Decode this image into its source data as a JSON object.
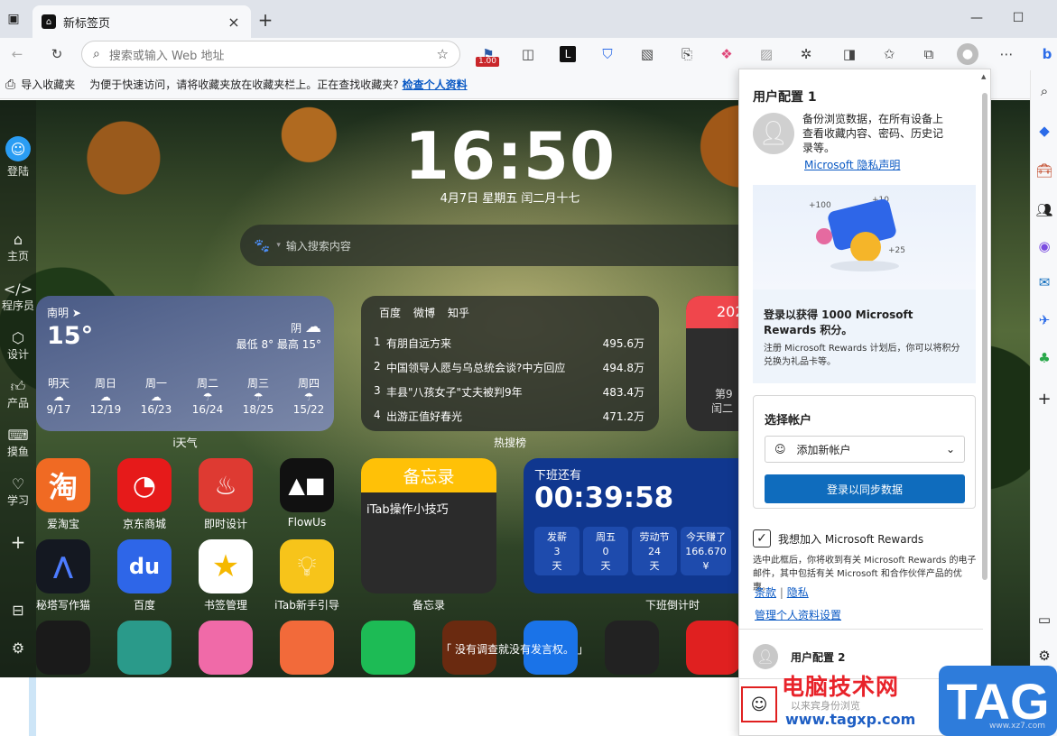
{
  "browser": {
    "tab_title": "新标签页",
    "address_placeholder": "搜索或输入 Web 地址",
    "extension_badge": "1.00",
    "favorites_bar": {
      "import_label": "导入收藏夹",
      "hint": "为便于快速访问，请将收藏夹放在收藏夹栏上。正在查找收藏夹?",
      "link": "检查个人资料"
    }
  },
  "itab": {
    "login_label": "登陆",
    "nav": [
      "主页",
      "程序员",
      "设计",
      "产品",
      "摸鱼",
      "学习"
    ],
    "clock": {
      "time": "16:50",
      "date": "4月7日  星期五  闰二月十七"
    },
    "search_placeholder": "输入搜索内容",
    "weather": {
      "city": "南明",
      "temp": "15°",
      "condition": "阴",
      "range": "最低 8° 最高 15°",
      "days": [
        {
          "name": "明天",
          "range": "9/17"
        },
        {
          "name": "周日",
          "range": "12/19"
        },
        {
          "name": "周一",
          "range": "16/23"
        },
        {
          "name": "周二",
          "range": "16/24"
        },
        {
          "name": "周三",
          "range": "18/25"
        },
        {
          "name": "周四",
          "range": "15/22"
        }
      ],
      "label": "i天气"
    },
    "hot": {
      "tabs": [
        "百度",
        "微博",
        "知乎"
      ],
      "items": [
        {
          "n": "1",
          "title": "有朋自远方来",
          "value": "495.6万"
        },
        {
          "n": "2",
          "title": "中国领导人愿与乌总统会谈?中方回应",
          "value": "494.8万"
        },
        {
          "n": "3",
          "title": "丰县\"八孩女子\"丈夫被判9年",
          "value": "483.4万"
        },
        {
          "n": "4",
          "title": "出游正值好春光",
          "value": "471.2万"
        }
      ],
      "label": "热搜榜"
    },
    "calendar": {
      "year_partial": "202",
      "line1": "第9",
      "line2": "闰二"
    },
    "apps_row1": [
      "爱淘宝",
      "京东商城",
      "即时设计",
      "FlowUs"
    ],
    "apps_row2": [
      "秘塔写作猫",
      "百度",
      "书签管理",
      "iTab新手引导"
    ],
    "memo": {
      "title": "备忘录",
      "item": "iTab操作小技巧",
      "label": "备忘录"
    },
    "countdown": {
      "title": "下班还有",
      "time": "00:39:58",
      "cells": [
        {
          "name": "发薪",
          "value": "3",
          "unit": "天"
        },
        {
          "name": "周五",
          "value": "0",
          "unit": "天"
        },
        {
          "name": "劳动节",
          "value": "24",
          "unit": "天"
        },
        {
          "name": "今天赚了",
          "value": "166.670",
          "unit": "¥"
        }
      ],
      "label": "下班倒计时"
    },
    "quote": "「 没有调查就没有发言权。 」"
  },
  "profile_panel": {
    "title": "用户配置 1",
    "sync_desc": "备份浏览数据，在所有设备上查看收藏内容、密码、历史记录等。",
    "privacy_link": "Microsoft 隐私声明",
    "rewards_title": "登录以获得 1000 Microsoft Rewards 积分。",
    "rewards_desc": "注册 Microsoft Rewards 计划后，你可以将积分兑换为礼品卡等。",
    "choose_account": "选择帐户",
    "add_account": "添加新帐户",
    "signin_button": "登录以同步数据",
    "join_rewards": "我想加入 Microsoft Rewards",
    "join_desc": "选中此框后，你将收到有关 Microsoft Rewards 的电子邮件，其中包括有关 Microsoft 和合作伙伴产品的优惠。",
    "terms": "条款",
    "privacy": "隐私",
    "manage": "管理个人资料设置",
    "profile2": "用户配置 2",
    "guest": "以来宾身份浏览",
    "rewards_card_numbers": [
      "+100",
      "+10",
      "+25"
    ]
  },
  "watermark": {
    "site": "电脑技术网",
    "url": "www.tagxp.com",
    "tag": "TAG",
    "faint": "www.xz7.com"
  },
  "colors": {
    "accent": "#0f6cbd",
    "link": "#0a59c4",
    "countdown": "#10378f",
    "memo_header": "#ffc107",
    "weather": "#5a6a92"
  }
}
